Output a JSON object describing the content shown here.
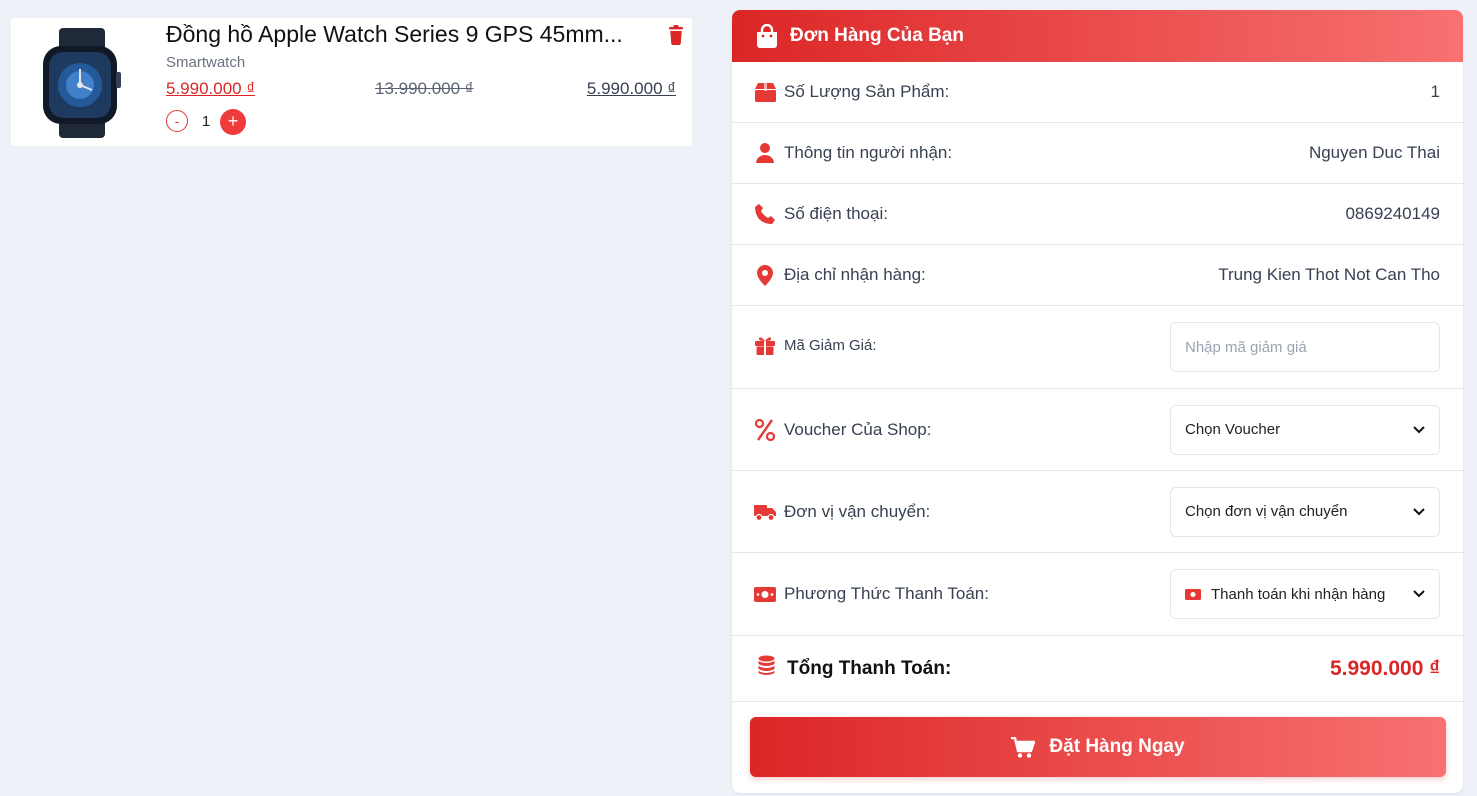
{
  "colors": {
    "accent": "#dc2626",
    "accent_light": "#f87171",
    "page_bg": "#eef1f7"
  },
  "product": {
    "name": "Đồng hồ Apple Watch Series 9 GPS 45mm...",
    "category": "Smartwatch",
    "price_sale": "5.990.000 ₫",
    "price_old": "13.990.000 ₫",
    "price_total": "5.990.000 ₫",
    "quantity": "1",
    "minus_label": "-",
    "plus_label": "+"
  },
  "order": {
    "title": "Đơn Hàng Của Bạn",
    "quantity_label": "Số Lượng Sản Phẩm:",
    "quantity_value": "1",
    "recipient_label": "Thông tin người nhận:",
    "recipient_value": "Nguyen Duc Thai",
    "phone_label": "Số điện thoại:",
    "phone_value": "0869240149",
    "address_label": "Địa chỉ nhận hàng:",
    "address_value": "Trung Kien Thot Not Can Tho",
    "discount_label": "Mã Giảm Giá:",
    "discount_placeholder": "Nhập mã giảm giá",
    "voucher_label": "Voucher Của Shop:",
    "voucher_selected": "Chọn Voucher",
    "shipping_label": "Đơn vị vận chuyển:",
    "shipping_selected": "Chọn đơn vị vận chuyển",
    "payment_label": "Phương Thức Thanh Toán:",
    "payment_selected": "Thanh toán khi nhận hàng",
    "total_label": "Tổng Thanh Toán:",
    "total_value": "5.990.000 ₫",
    "order_button": "Đặt Hàng Ngay"
  },
  "icons": [
    "watch-image",
    "trash-icon",
    "shopping-bag-icon",
    "box-icon",
    "user-icon",
    "phone-icon",
    "map-pin-icon",
    "gift-icon",
    "percent-icon",
    "truck-icon",
    "money-icon",
    "chevron-down-icon",
    "coins-icon",
    "cart-icon"
  ]
}
